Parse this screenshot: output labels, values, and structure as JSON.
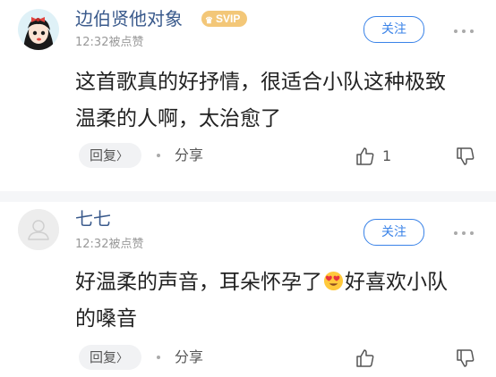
{
  "comments": [
    {
      "username": "边伯贤他对象",
      "vip_badge": "SVIP",
      "timestamp": "12:32被点赞",
      "follow_label": "关注",
      "text": "这首歌真的好抒情，很适合小队这种极致温柔的人啊，太治愈了",
      "reply_label": "回复",
      "reply_chevron": "〉",
      "share_label": "分享",
      "like_count": "1"
    },
    {
      "username": "七七",
      "timestamp": "12:32被点赞",
      "follow_label": "关注",
      "text_before_emoji": "好温柔的声音，耳朵怀孕了",
      "emoji": "heart-eyes-emoji",
      "text_after_emoji": "好喜欢小队的嗓音",
      "reply_label": "回复",
      "reply_chevron": "〉",
      "share_label": "分享",
      "like_count": ""
    }
  ],
  "colors": {
    "username": "#3a5a8c",
    "accent": "#3a83e8",
    "vip_badge": "#f3c778",
    "text": "#222222",
    "meta": "#999999",
    "separator": "#f5f6f8"
  }
}
